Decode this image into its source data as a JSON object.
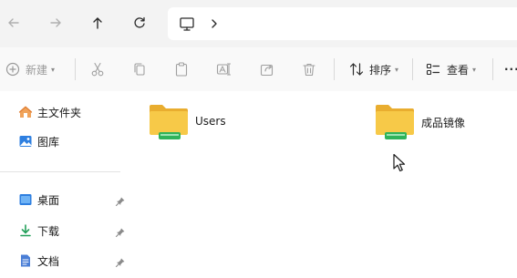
{
  "toolbar": {
    "new_label": "新建",
    "sort_label": "排序",
    "view_label": "查看",
    "more_label": "···"
  },
  "sidebar": {
    "items": [
      {
        "label": "主文件夹",
        "icon": "home-icon"
      },
      {
        "label": "图库",
        "icon": "gallery-icon"
      },
      {
        "label": "桌面",
        "icon": "desktop-icon",
        "pinned": true
      },
      {
        "label": "下载",
        "icon": "download-icon",
        "pinned": true
      },
      {
        "label": "文档",
        "icon": "documents-icon",
        "pinned": true
      }
    ]
  },
  "main": {
    "items": [
      {
        "name": "Users",
        "type": "folder"
      },
      {
        "name": "成品镜像",
        "type": "folder"
      }
    ]
  },
  "colors": {
    "folder_yellow": "#f5c34b",
    "folder_back": "#e9ad2f",
    "drive_green": "#2fb35a",
    "accent_blue": "#1f6fd1"
  }
}
